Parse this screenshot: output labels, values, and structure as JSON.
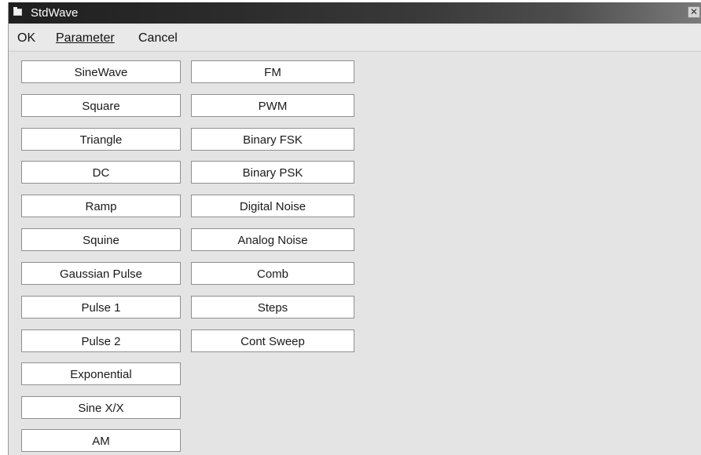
{
  "window": {
    "title": "StdWave",
    "close_glyph": "✕"
  },
  "menu": {
    "ok": "OK",
    "parameter": "Parameter",
    "cancel": "Cancel"
  },
  "buttons_col1": [
    "SineWave",
    "Square",
    "Triangle",
    "DC",
    "Ramp",
    "Squine",
    "Gaussian Pulse",
    "Pulse 1",
    "Pulse 2",
    "Exponential",
    "Sine X/X",
    "AM"
  ],
  "buttons_col2": [
    "FM",
    "PWM",
    "Binary FSK",
    "Binary PSK",
    "Digital Noise",
    "Analog Noise",
    "Comb",
    "Steps",
    "Cont Sweep"
  ]
}
